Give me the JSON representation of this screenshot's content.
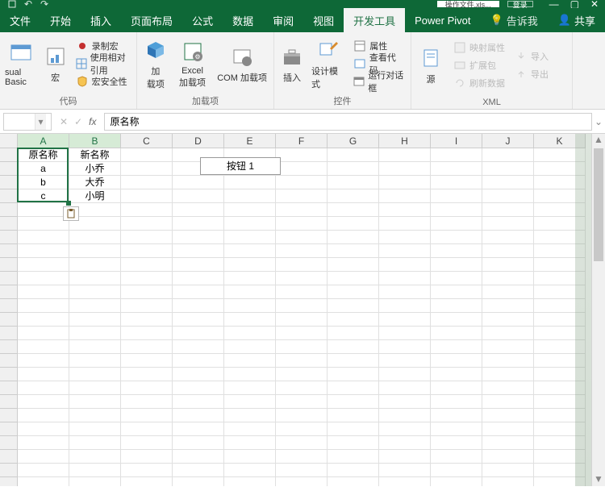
{
  "title_filename": "操作文件.xls...",
  "title_login": "登录",
  "tabs": {
    "file": "文件",
    "home": "开始",
    "insert": "插入",
    "layout": "页面布局",
    "formulas": "公式",
    "data": "数据",
    "review": "审阅",
    "view": "视图",
    "developer": "开发工具",
    "powerpivot": "Power Pivot",
    "tellme": "告诉我",
    "share": "共享"
  },
  "ribbon": {
    "visual_basic": "sual Basic",
    "macros": "宏",
    "record_macro": "录制宏",
    "relative_ref": "使用相对引用",
    "macro_security": "宏安全性",
    "code_label": "代码",
    "addins": "加\n载项",
    "excel_addins": "Excel\n加载项",
    "com_addins": "COM 加载项",
    "addins_label": "加载项",
    "insert_ctrl": "插入",
    "design_mode": "设计模式",
    "properties": "属性",
    "view_code": "查看代码",
    "run_dialog": "运行对话框",
    "controls_label": "控件",
    "source": "源",
    "map_properties": "映射属性",
    "expansion": "扩展包",
    "refresh_data": "刷新数据",
    "import": "导入",
    "export": "导出",
    "xml_label": "XML"
  },
  "formula_bar_value": "原名称",
  "columns": [
    "A",
    "B",
    "C",
    "D",
    "E",
    "F",
    "G",
    "H",
    "I",
    "J",
    "K"
  ],
  "sheet_data": {
    "headers": [
      "原名称",
      "新名称"
    ],
    "rows": [
      [
        "a",
        "小乔"
      ],
      [
        "b",
        "大乔"
      ],
      [
        "c",
        "小明"
      ]
    ]
  },
  "button_label": "按钮 1",
  "chart_data": {
    "type": "table",
    "title": "",
    "columns": [
      "原名称",
      "新名称"
    ],
    "rows": [
      [
        "a",
        "小乔"
      ],
      [
        "b",
        "大乔"
      ],
      [
        "c",
        "小明"
      ]
    ]
  }
}
